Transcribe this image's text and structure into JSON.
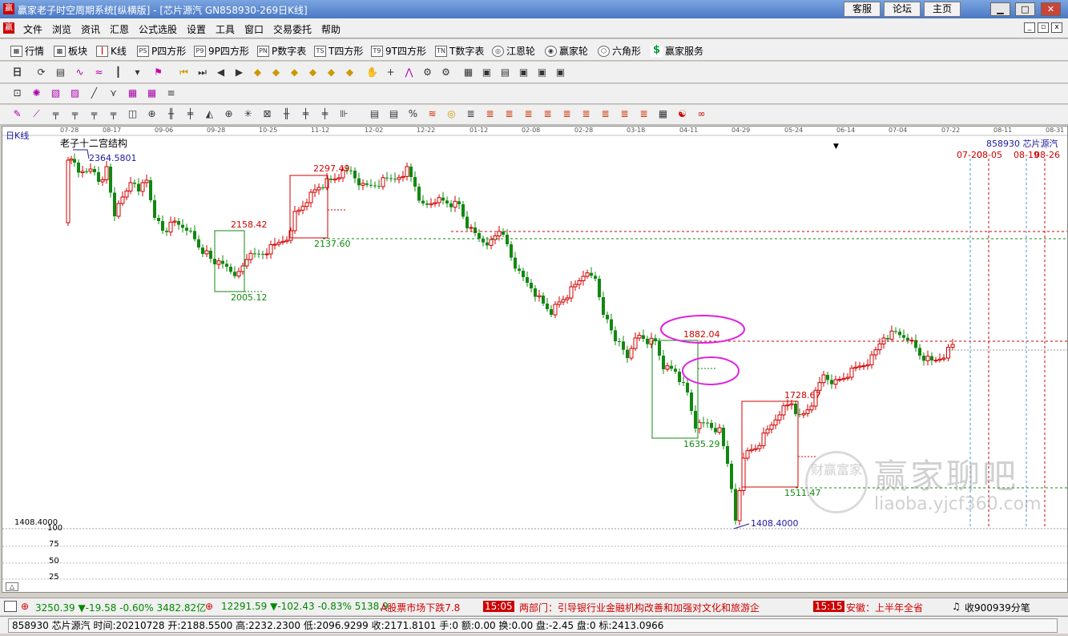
{
  "window": {
    "title": "赢家老子时空周期系统[纵横版] - [芯片源汽  GN858930-269日K线]",
    "links": [
      "客服",
      "论坛",
      "主页"
    ]
  },
  "menu": [
    "文件",
    "浏览",
    "资讯",
    "汇恩",
    "公式选股",
    "设置",
    "工具",
    "窗口",
    "交易委托",
    "帮助"
  ],
  "toolbar1": [
    {
      "icon": "table-icon",
      "label": "行情"
    },
    {
      "icon": "blocks-icon",
      "label": "板块"
    },
    {
      "icon": "candle-icon",
      "label": "K线"
    },
    {
      "icon": "ps-icon",
      "label": "P四方形"
    },
    {
      "icon": "p9-icon",
      "label": "9P四方形"
    },
    {
      "icon": "pn-icon",
      "label": "P数字表"
    },
    {
      "icon": "ts-icon",
      "label": "T四方形"
    },
    {
      "icon": "t9-icon",
      "label": "9T四方形"
    },
    {
      "icon": "tn-icon",
      "label": "T数字表"
    },
    {
      "icon": "spiral-icon",
      "label": "江恩轮"
    },
    {
      "icon": "wheel-icon",
      "label": "赢家轮"
    },
    {
      "icon": "hexagon-icon",
      "label": "六角形"
    },
    {
      "icon": "dollar-icon",
      "label": "赢家服务"
    }
  ],
  "chart": {
    "type_label": "日K线",
    "structure_label": "老子十二宫结构",
    "stock_label": "858930  芯片源汽",
    "date_ticks": [
      "07-28",
      "08-17",
      "09-06",
      "09-28",
      "10-25",
      "11-12",
      "12-02",
      "12-22",
      "01-12",
      "02-08",
      "02-28",
      "03-18",
      "04-11",
      "04-29",
      "05-24",
      "06-14",
      "07-04",
      "07-22",
      "08-11",
      "08-31"
    ],
    "future_dates": [
      "07-20",
      "08-05",
      "08-19",
      "08-26"
    ],
    "price_labels": [
      {
        "text": "2364.5801",
        "color": "#1a1aa0"
      },
      {
        "text": "2297.49",
        "color": "#d00000"
      },
      {
        "text": "2158.42",
        "color": "#d00000"
      },
      {
        "text": "2137.60",
        "color": "#118811"
      },
      {
        "text": "2005.12",
        "color": "#118811"
      },
      {
        "text": "1882.04",
        "color": "#d00000"
      },
      {
        "text": "1728.67",
        "color": "#d00000"
      },
      {
        "text": "1635.29",
        "color": "#118811"
      },
      {
        "text": "1511.47",
        "color": "#118811"
      },
      {
        "text": "1408.4000",
        "color": "#1a1aa0"
      }
    ],
    "left_price_label": "1408.4000",
    "lower_axis": [
      "100",
      "75",
      "50",
      "25"
    ],
    "watermark": {
      "title": "赢家聊吧",
      "url": "liaoba.yjcf360.com",
      "seal": "财赢富家"
    }
  },
  "ticker": {
    "index1": {
      "value": "3250.39",
      "change": "▼-19.58",
      "pct": "-0.60%",
      "amount": "3482.82亿"
    },
    "index2": {
      "value": "12291.59",
      "change": "▼-102.43",
      "pct": "-0.83%",
      "amount": "5138.9"
    },
    "news1": "A股票市场下跌7.8",
    "time1": "15:05",
    "news2": "两部门：引导银行业金融机构改善和加强对文化和旅游企",
    "time2": "15:15",
    "news3": "安徽：上半年全省",
    "right_text": "收900939分笔"
  },
  "status_line": "858930 芯片源汽 时间:20210728 开:2188.5500 高:2232.2300 低:2096.9299 收:2171.8101 手:0 额:0.00 换:0.00 盘:-2.45 盘:0 标:2413.0966",
  "colors": {
    "up": "#d00000",
    "down": "#118811",
    "magenta": "#e020e0"
  }
}
